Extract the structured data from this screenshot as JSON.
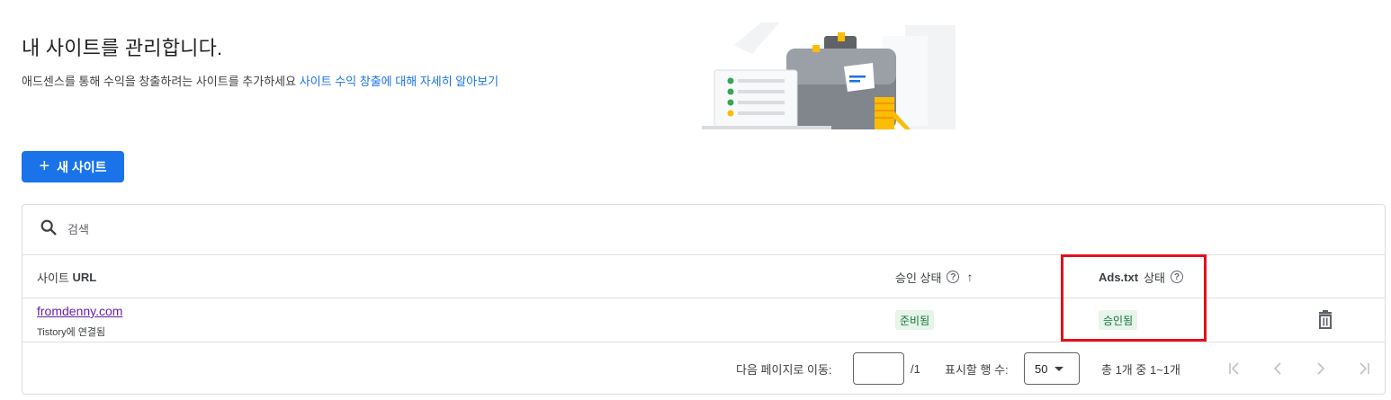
{
  "page": {
    "title": "내 사이트를 관리합니다.",
    "subtitle_text": "애드센스를 통해 수익을 창출하려는 사이트를 추가하세요",
    "subtitle_link": "사이트 수익 창출에 대해 자세히 알아보기"
  },
  "add_button": {
    "icon": "plus-icon",
    "label": "새 사이트"
  },
  "search": {
    "icon": "search-icon",
    "placeholder": "검색"
  },
  "table": {
    "headers": {
      "site_prefix": "사이트 ",
      "site_url": "URL",
      "approval": "승인 상태",
      "adstxt_bold": "Ads.txt",
      "adstxt_rest": "상태"
    },
    "rows": [
      {
        "url": "fromdenny.com",
        "sub": "Tistory에 연결됨",
        "approval_status": "준비됨",
        "adstxt_status": "승인됨"
      }
    ]
  },
  "pagination": {
    "goto_label": "다음 페이지로 이동:",
    "page_value": "",
    "page_total": "/1",
    "rows_label": "표시할 행 수:",
    "rows_value": "50",
    "range_text": "총 1개 중 1~1개"
  },
  "colors": {
    "primary": "#1a73e8",
    "link_visited": "#681da8",
    "chip_bg": "#e6f4ea",
    "chip_text": "#137333",
    "highlight": "#e3101b"
  }
}
